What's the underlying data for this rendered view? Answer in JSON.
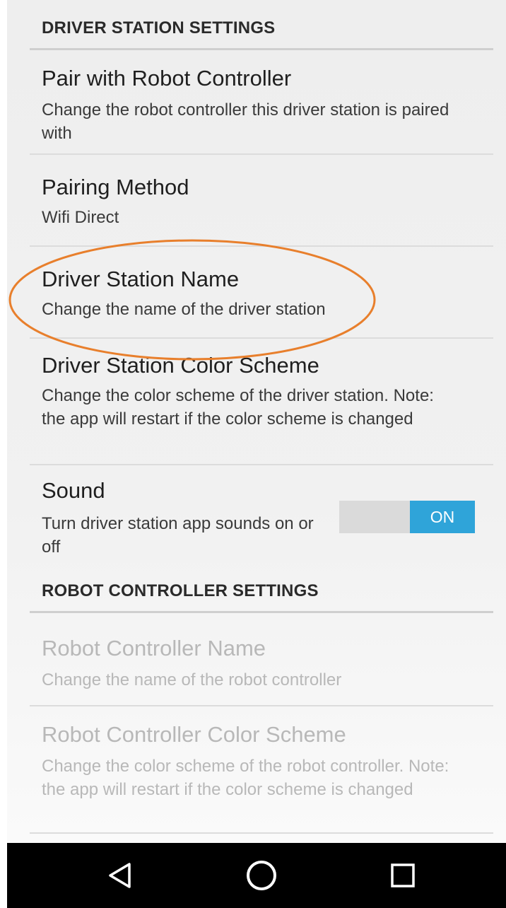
{
  "driver_station_settings": {
    "header": "DRIVER STATION SETTINGS",
    "items": [
      {
        "title": "Pair with Robot Controller",
        "summary": "Change the robot controller this driver station is paired with"
      },
      {
        "title": "Pairing Method",
        "summary": "Wifi Direct"
      },
      {
        "title": "Driver Station Name",
        "summary": "Change the name of the driver station"
      },
      {
        "title": "Driver Station Color Scheme",
        "summary": "Change the color scheme of the driver station. Note: the app will restart if the color scheme is changed"
      },
      {
        "title": "Sound",
        "summary": "Turn driver station app sounds on or off",
        "toggle_label": "ON"
      }
    ]
  },
  "robot_controller_settings": {
    "header": "ROBOT CONTROLLER SETTINGS",
    "items": [
      {
        "title": "Robot Controller Name",
        "summary": "Change the name of the robot controller"
      },
      {
        "title": "Robot Controller Color Scheme",
        "summary": "Change the color scheme of the robot controller. Note: the app will restart if the color scheme is changed"
      }
    ]
  },
  "navbar": {
    "icons": [
      "back-icon",
      "home-icon",
      "recents-icon"
    ]
  },
  "colors": {
    "toggle_on": "#2fa4d9",
    "highlight_oval": "#e87f2c",
    "disabled_text": "#b8b8b8"
  }
}
